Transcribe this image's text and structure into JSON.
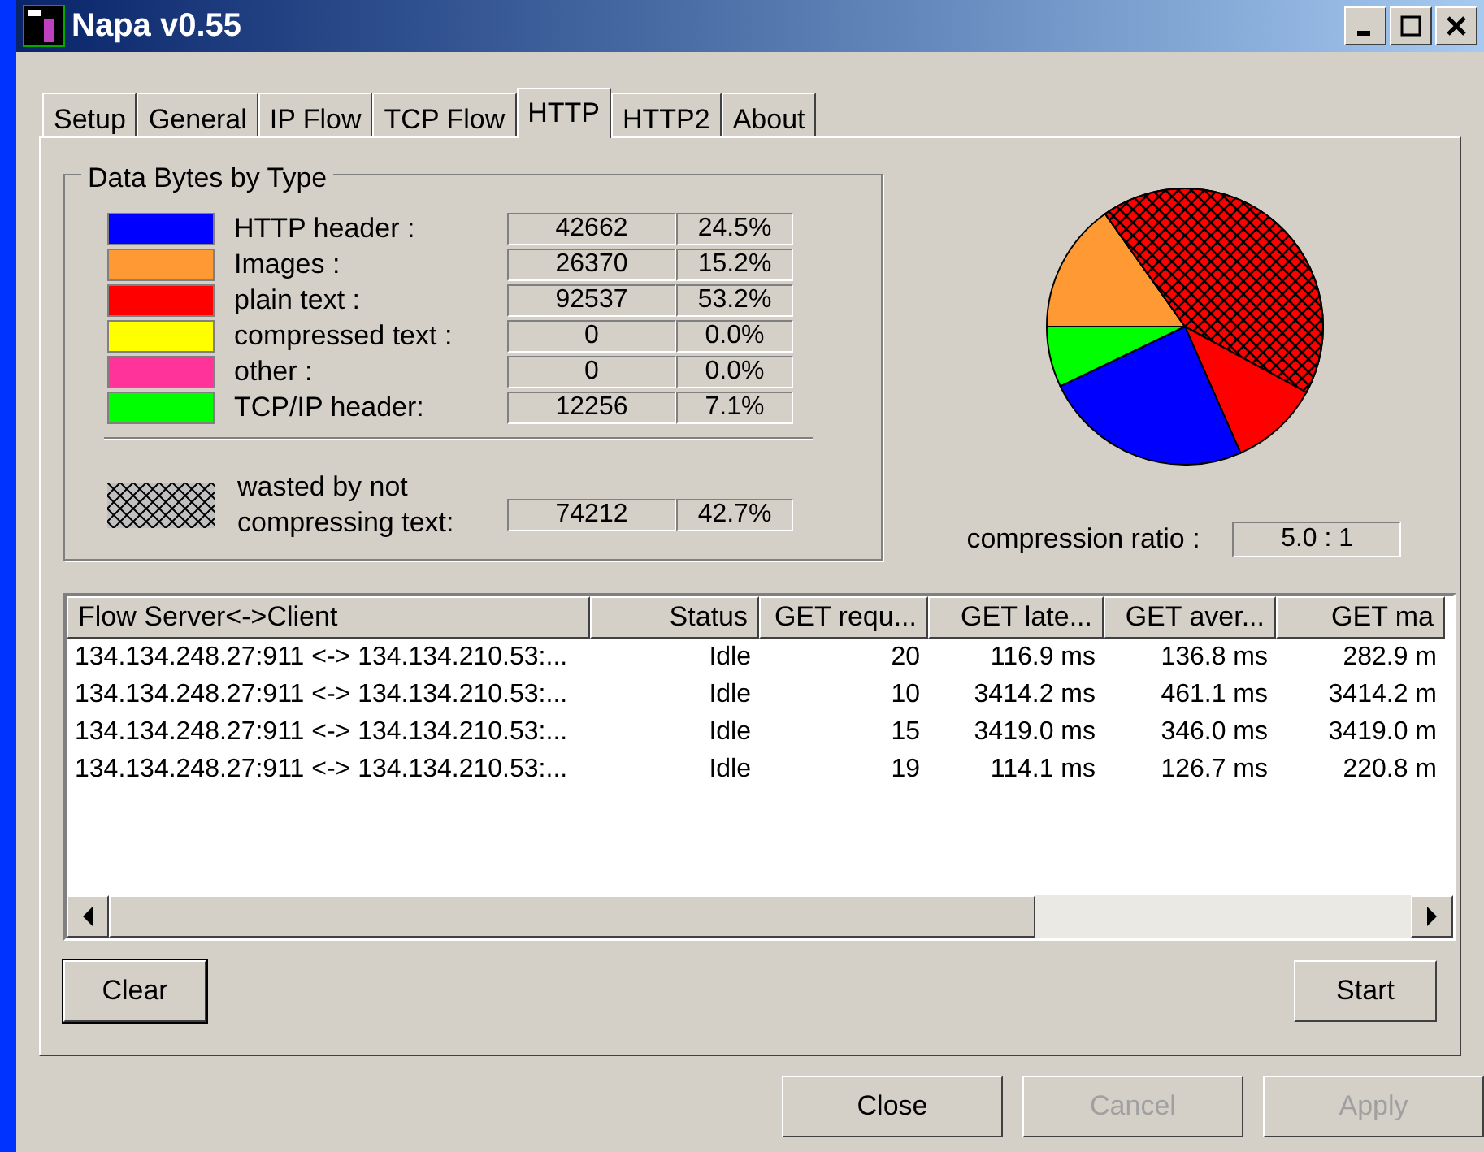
{
  "window": {
    "title": "Napa v0.55"
  },
  "tabs": [
    {
      "label": "Setup",
      "selected": false
    },
    {
      "label": "General",
      "selected": false
    },
    {
      "label": "IP Flow",
      "selected": false
    },
    {
      "label": "TCP Flow",
      "selected": false
    },
    {
      "label": "HTTP",
      "selected": true
    },
    {
      "label": "HTTP2",
      "selected": false
    },
    {
      "label": "About",
      "selected": false
    }
  ],
  "data_bytes": {
    "title": "Data Bytes by Type",
    "rows": [
      {
        "label": "HTTP header :",
        "color": "#0000ff",
        "bytes": "42662",
        "percent": "24.5%"
      },
      {
        "label": "Images :",
        "color": "#ff9933",
        "bytes": "26370",
        "percent": "15.2%"
      },
      {
        "label": "plain text :",
        "color": "#ff0000",
        "bytes": "92537",
        "percent": "53.2%"
      },
      {
        "label": "compressed text :",
        "color": "#ffff00",
        "bytes": "0",
        "percent": "0.0%"
      },
      {
        "label": "other :",
        "color": "#ff3399",
        "bytes": "0",
        "percent": "0.0%"
      },
      {
        "label": "TCP/IP header:",
        "color": "#00ff00",
        "bytes": "12256",
        "percent": "7.1%"
      }
    ],
    "wasted": {
      "label": "wasted by not compressing text:",
      "bytes": "74212",
      "percent": "42.7%"
    }
  },
  "compression_ratio": {
    "label": "compression ratio :",
    "value": "5.0 : 1"
  },
  "table": {
    "columns": [
      "Flow Server<->Client",
      "Status",
      "GET requ...",
      "GET late...",
      "GET aver...",
      "GET ma"
    ],
    "rows": [
      [
        "134.134.248.27:911 <-> 134.134.210.53:...",
        "Idle",
        "20",
        "116.9 ms",
        "136.8 ms",
        "282.9 m"
      ],
      [
        "134.134.248.27:911 <-> 134.134.210.53:...",
        "Idle",
        "10",
        "3414.2 ms",
        "461.1 ms",
        "3414.2 m"
      ],
      [
        "134.134.248.27:911 <-> 134.134.210.53:...",
        "Idle",
        "15",
        "3419.0 ms",
        "346.0 ms",
        "3419.0 m"
      ],
      [
        "134.134.248.27:911 <-> 134.134.210.53:...",
        "Idle",
        "19",
        "114.1 ms",
        "126.7 ms",
        "220.8 m"
      ]
    ]
  },
  "panel_buttons": [
    {
      "label": "Clear",
      "disabled": false
    },
    {
      "label": "Start",
      "disabled": false
    }
  ],
  "dialog_buttons": [
    {
      "label": "Close",
      "disabled": false
    },
    {
      "label": "Cancel",
      "disabled": true
    },
    {
      "label": "Apply",
      "disabled": true
    }
  ]
}
